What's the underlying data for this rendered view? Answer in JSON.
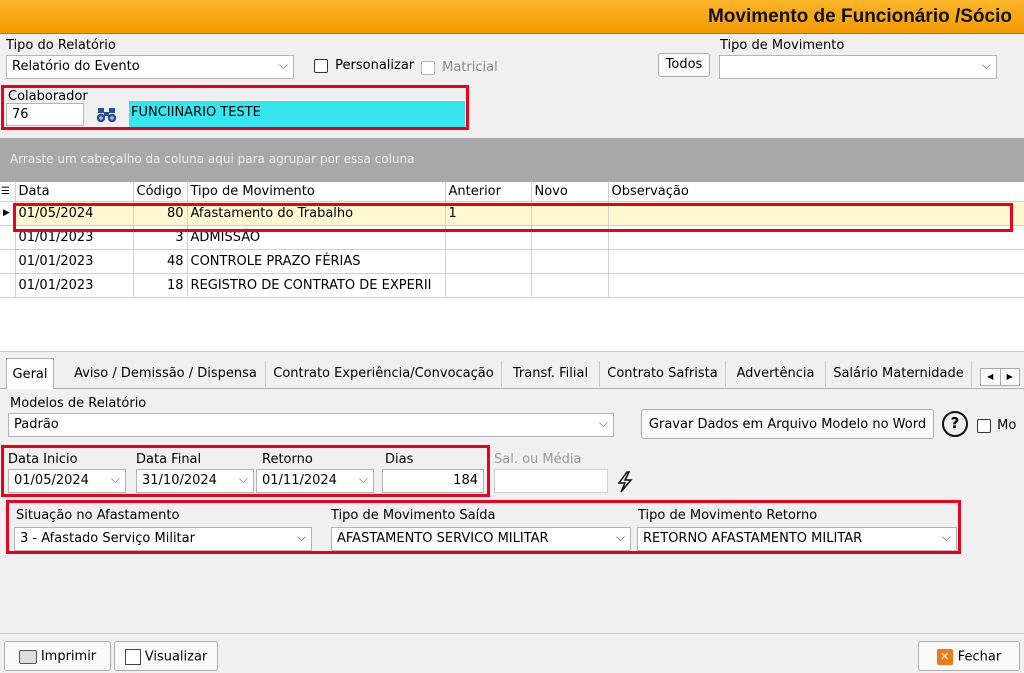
{
  "title": "Movimento de Funcionário /Sócio",
  "report": {
    "tipo_label": "Tipo do Relatório",
    "tipo_value": "Relatório do Evento",
    "personalizar_label": "Personalizar",
    "matricial_label": "Matricial",
    "todos_label": "Todos",
    "tipo_mov_label": "Tipo de Movimento",
    "tipo_mov_value": ""
  },
  "colaborador": {
    "label": "Colaborador",
    "code": "76",
    "name": "FUNCIINARIO TESTE"
  },
  "grid": {
    "group_hint": "Arraste um cabeçalho da coluna aqui para agrupar por essa coluna",
    "columns": [
      "Data",
      "Código",
      "Tipo de Movimento",
      "Anterior",
      "Novo",
      "Observação"
    ],
    "rows": [
      {
        "data": "01/05/2024",
        "codigo": "80",
        "tipo": "Afastamento do Trabalho",
        "anterior": "1",
        "novo": "",
        "obs": ""
      },
      {
        "data": "01/01/2023",
        "codigo": "3",
        "tipo": "ADMISSÃO",
        "anterior": "",
        "novo": "",
        "obs": ""
      },
      {
        "data": "01/01/2023",
        "codigo": "48",
        "tipo": "CONTROLE PRAZO FÉRIAS",
        "anterior": "",
        "novo": "",
        "obs": ""
      },
      {
        "data": "01/01/2023",
        "codigo": "18",
        "tipo": "REGISTRO DE CONTRATO DE EXPERII",
        "anterior": "",
        "novo": "",
        "obs": ""
      }
    ]
  },
  "tabs": [
    "Geral",
    "Aviso / Demissão / Dispensa",
    "Contrato Experiência/Convocação",
    "Transf. Filial",
    "Contrato Safrista",
    "Advertência",
    "Salário Maternidade"
  ],
  "geral": {
    "modelos_label": "Modelos de Relatório",
    "modelos_value": "Padrão",
    "gravar_label": "Gravar Dados em Arquivo Modelo no Word",
    "mo_label": "Mo",
    "data_inicio_label": "Data Inicio",
    "data_inicio": "01/05/2024",
    "data_final_label": "Data Final",
    "data_final": "31/10/2024",
    "retorno_label": "Retorno",
    "retorno": "01/11/2024",
    "dias_label": "Dias",
    "dias": "184",
    "sal_media_label": "Sal. ou Média",
    "sal_media": "",
    "situacao_label": "Situação no Afastamento",
    "situacao_value": "3 - Afastado Serviço Militar",
    "mov_saida_label": "Tipo de Movimento Saída",
    "mov_saida_value": "AFASTAMENTO SERVICO MILITAR",
    "mov_retorno_label": "Tipo de Movimento Retorno",
    "mov_retorno_value": "RETORNO AFASTAMENTO MILITAR"
  },
  "footer": {
    "imprimir": "Imprimir",
    "visualizar": "Visualizar",
    "fechar": "Fechar"
  },
  "colors": {
    "title_bar": "#f7a600",
    "highlight_red": "#e8001c",
    "name_field_bg": "#33e6f0",
    "selected_row": "#fff8d0"
  }
}
